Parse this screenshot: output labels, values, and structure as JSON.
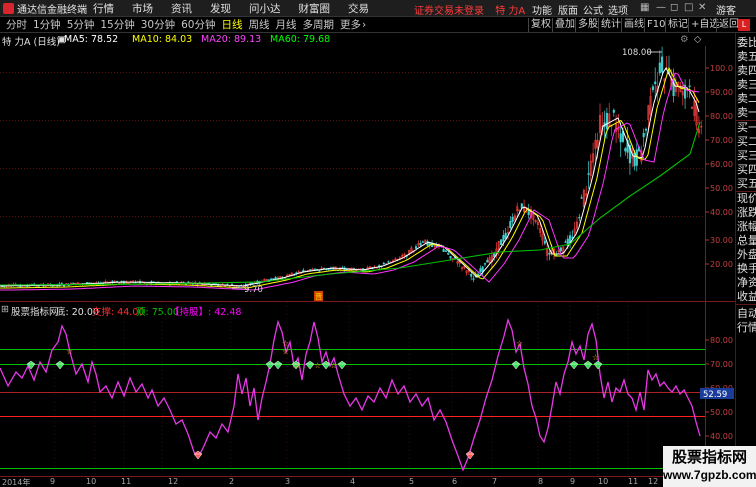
{
  "menubar": {
    "app_title": "通达信金融终端",
    "items": [
      "行情",
      "市场",
      "资讯",
      "发现",
      "问小达",
      "财富圈",
      "交易"
    ],
    "login_status": "证券交易未登录",
    "stock_display": "特 力A",
    "right_buttons": [
      "功能",
      "版面",
      "公式",
      "选项"
    ],
    "guest": "游客"
  },
  "toolbar": {
    "periods": [
      "分时",
      "1分钟",
      "5分钟",
      "15分钟",
      "30分钟",
      "60分钟",
      "日线",
      "周线",
      "月线",
      "多周期",
      "更多"
    ],
    "active_period": "日线",
    "right_buttons": [
      "复权",
      "叠加",
      "多股",
      "统计",
      "画线",
      "F10",
      "标记",
      "+自选",
      "返回"
    ]
  },
  "main_info": {
    "stock_label": "特 力A (日线)",
    "ma5": "MA5: 78.52",
    "ma10": "MA10: 84.03",
    "ma20": "MA20: 89.13",
    "ma60": "MA60: 79.68",
    "colors": {
      "ma5": "#ffffff",
      "ma10": "#ffff00",
      "ma20": "#ff00ff",
      "ma60": "#00ff00",
      "label": "#e0e0e0"
    }
  },
  "main_chart": {
    "y_ticks": [
      "100.0",
      "90.00",
      "80.00",
      "70.00",
      "60.00",
      "50.00",
      "40.00",
      "30.00",
      "20.00"
    ],
    "max_label": "108.00",
    "min_label": "9.70",
    "marker": "晋"
  },
  "indicator": {
    "name": "股票指标网",
    "param_low": "底: 20.00",
    "param_mid": "支撑: 44.00",
    "param_high": "顶: 75.00",
    "value_label": "【持股】: 42.48",
    "current_value": "52.59",
    "y_ticks": [
      "80.00",
      "70.00",
      "60.00",
      "50.00",
      "40.00",
      "30.00",
      "20.00"
    ],
    "colors": {
      "line": "#e838e8",
      "low": "#00ff00",
      "mid": "#ff3030",
      "high": "#00c000",
      "value": "#ff00ff"
    }
  },
  "date_axis": [
    "2014年",
    "9",
    "10",
    "11",
    "12",
    "2",
    "3",
    "4",
    "5",
    "6",
    "7",
    "8",
    "9",
    "10",
    "11",
    "12"
  ],
  "right_panel": [
    "委比",
    "卖五",
    "卖四",
    "卖三",
    "卖二",
    "卖一",
    "买一",
    "买二",
    "买三",
    "买四",
    "买五",
    "现价",
    "涨跌",
    "涨幅",
    "总量",
    "外盘",
    "换手",
    "净资",
    "收益",
    "自动",
    "行情"
  ],
  "right_panel_badge": "L",
  "watermark": {
    "title": "股票指标网",
    "url": "www.7gpzb.com"
  }
}
